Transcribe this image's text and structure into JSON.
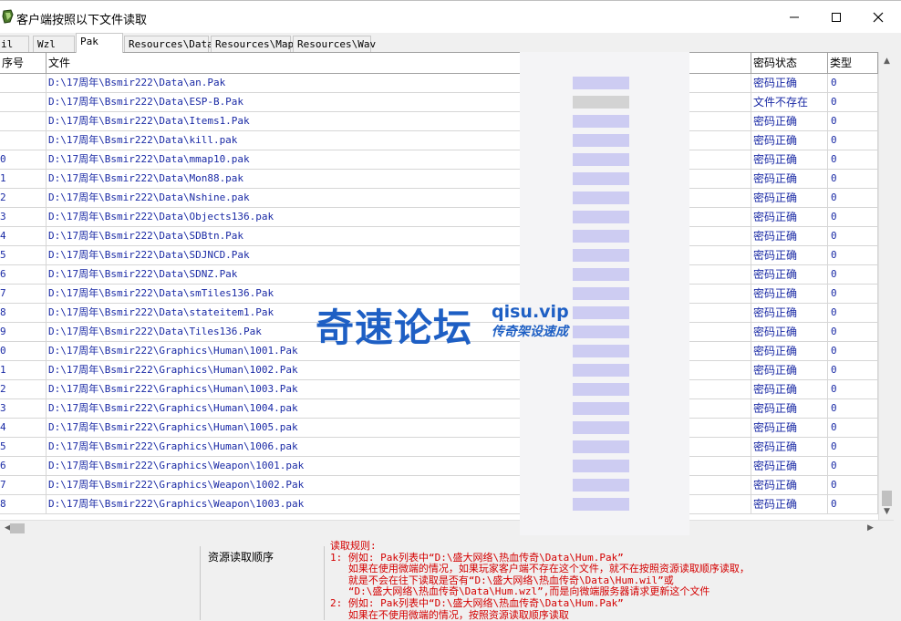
{
  "window": {
    "title": "客户端按照以下文件读取"
  },
  "tabs": [
    {
      "label": "il"
    },
    {
      "label": "Wzl"
    },
    {
      "label": "Pak"
    },
    {
      "label": "Resources\\Data"
    },
    {
      "label": "Resources\\Map"
    },
    {
      "label": "Resources\\Wav"
    }
  ],
  "grid": {
    "headers": {
      "index": "序号",
      "file": "文件",
      "status": "密码状态",
      "type": "类型"
    },
    "rows": [
      {
        "index": "",
        "file": "D:\\17周年\\Bsmir222\\Data\\an.Pak",
        "status": "密码正确",
        "type": "0"
      },
      {
        "index": "",
        "file": "D:\\17周年\\Bsmir222\\Data\\ESP-B.Pak",
        "status": "文件不存在",
        "type": "0"
      },
      {
        "index": "",
        "file": "D:\\17周年\\Bsmir222\\Data\\Items1.Pak",
        "status": "密码正确",
        "type": "0"
      },
      {
        "index": "",
        "file": "D:\\17周年\\Bsmir222\\Data\\kill.pak",
        "status": "密码正确",
        "type": "0"
      },
      {
        "index": "0",
        "file": "D:\\17周年\\Bsmir222\\Data\\mmap10.pak",
        "status": "密码正确",
        "type": "0"
      },
      {
        "index": "1",
        "file": "D:\\17周年\\Bsmir222\\Data\\Mon88.pak",
        "status": "密码正确",
        "type": "0"
      },
      {
        "index": "2",
        "file": "D:\\17周年\\Bsmir222\\Data\\Nshine.pak",
        "status": "密码正确",
        "type": "0"
      },
      {
        "index": "3",
        "file": "D:\\17周年\\Bsmir222\\Data\\Objects136.pak",
        "status": "密码正确",
        "type": "0"
      },
      {
        "index": "4",
        "file": "D:\\17周年\\Bsmir222\\Data\\SDBtn.Pak",
        "status": "密码正确",
        "type": "0"
      },
      {
        "index": "5",
        "file": "D:\\17周年\\Bsmir222\\Data\\SDJNCD.Pak",
        "status": "密码正确",
        "type": "0"
      },
      {
        "index": "6",
        "file": "D:\\17周年\\Bsmir222\\Data\\SDNZ.Pak",
        "status": "密码正确",
        "type": "0"
      },
      {
        "index": "7",
        "file": "D:\\17周年\\Bsmir222\\Data\\smTiles136.Pak",
        "status": "密码正确",
        "type": "0"
      },
      {
        "index": "8",
        "file": "D:\\17周年\\Bsmir222\\Data\\stateitem1.Pak",
        "status": "密码正确",
        "type": "0"
      },
      {
        "index": "9",
        "file": "D:\\17周年\\Bsmir222\\Data\\Tiles136.Pak",
        "status": "密码正确",
        "type": "0"
      },
      {
        "index": "0",
        "file": "D:\\17周年\\Bsmir222\\Graphics\\Human\\1001.Pak",
        "status": "密码正确",
        "type": "0"
      },
      {
        "index": "1",
        "file": "D:\\17周年\\Bsmir222\\Graphics\\Human\\1002.Pak",
        "status": "密码正确",
        "type": "0"
      },
      {
        "index": "2",
        "file": "D:\\17周年\\Bsmir222\\Graphics\\Human\\1003.Pak",
        "status": "密码正确",
        "type": "0"
      },
      {
        "index": "3",
        "file": "D:\\17周年\\Bsmir222\\Graphics\\Human\\1004.pak",
        "status": "密码正确",
        "type": "0"
      },
      {
        "index": "4",
        "file": "D:\\17周年\\Bsmir222\\Graphics\\Human\\1005.pak",
        "status": "密码正确",
        "type": "0"
      },
      {
        "index": "5",
        "file": "D:\\17周年\\Bsmir222\\Graphics\\Human\\1006.pak",
        "status": "密码正确",
        "type": "0"
      },
      {
        "index": "6",
        "file": "D:\\17周年\\Bsmir222\\Graphics\\Weapon\\1001.pak",
        "status": "密码正确",
        "type": "0"
      },
      {
        "index": "7",
        "file": "D:\\17周年\\Bsmir222\\Graphics\\Weapon\\1002.Pak",
        "status": "密码正确",
        "type": "0"
      },
      {
        "index": "8",
        "file": "D:\\17周年\\Bsmir222\\Graphics\\Weapon\\1003.pak",
        "status": "密码正确",
        "type": "0"
      }
    ]
  },
  "resource_order": {
    "label": "资源读取顺序"
  },
  "rules": {
    "lines": [
      "读取规则:",
      "1: 例如: Pak列表中“D:\\盛大网络\\热血传奇\\Data\\Hum.Pak”",
      "   如果在使用微端的情况，如果玩家客户端不存在这个文件，就不在按照资源读取顺序读取，",
      "   就是不会在往下读取是否有“D:\\盛大网络\\热血传奇\\Data\\Hum.wil”或",
      "   “D:\\盛大网络\\热血传奇\\Data\\Hum.wzl”,而是向微端服务器请求更新这个文件",
      "2: 例如: Pak列表中“D:\\盛大网络\\热血传奇\\Data\\Hum.Pak”",
      "   如果在不使用微端的情况，按照资源读取顺序读取"
    ]
  },
  "watermark": {
    "main": "奇速论坛",
    "domain": "qisu.vip",
    "sub": "传奇架设速成"
  },
  "colors": {
    "row_text": "#1a2aa5",
    "rules_text": "#d40000",
    "watermark": "#1e5fc4"
  }
}
